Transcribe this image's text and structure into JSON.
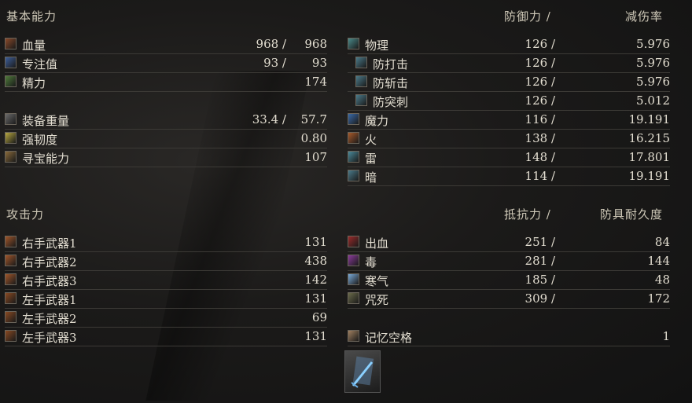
{
  "left": {
    "basic_header": "基本能力",
    "basic": [
      {
        "label": "血量",
        "a": "968 /",
        "b": "968",
        "color": "#8a4a2a",
        "icon": "hp-icon"
      },
      {
        "label": "专注值",
        "a": "93 /",
        "b": "93",
        "color": "#3d5f9a",
        "icon": "fp-icon"
      },
      {
        "label": "精力",
        "a": "",
        "b": "174",
        "color": "#4f7a3a",
        "icon": "stamina-icon"
      }
    ],
    "equip": [
      {
        "label": "装备重量",
        "a": "33.4 /",
        "b": "57.7",
        "color": "#6b6b6b",
        "icon": "equip-load-icon"
      },
      {
        "label": "强韧度",
        "a": "",
        "b": "0.80",
        "color": "#b8a840",
        "icon": "poise-icon"
      },
      {
        "label": "寻宝能力",
        "a": "",
        "b": "107",
        "color": "#8a6a3a",
        "icon": "discovery-icon"
      }
    ],
    "attack_header": "攻击力",
    "attack": [
      {
        "label": "右手武器1",
        "b": "131",
        "color": "#a0562a",
        "icon": "right-weapon-icon"
      },
      {
        "label": "右手武器2",
        "b": "438",
        "color": "#a0562a",
        "icon": "right-weapon-icon"
      },
      {
        "label": "右手武器3",
        "b": "142",
        "color": "#a0562a",
        "icon": "right-weapon-icon"
      },
      {
        "label": "左手武器1",
        "b": "131",
        "color": "#8a4a22",
        "icon": "left-weapon-icon"
      },
      {
        "label": "左手武器2",
        "b": "69",
        "color": "#8a4a22",
        "icon": "left-weapon-icon"
      },
      {
        "label": "左手武器3",
        "b": "131",
        "color": "#8a4a22",
        "icon": "left-weapon-icon"
      }
    ]
  },
  "right": {
    "def_header1": "防御力 /",
    "def_header2": "减伤率",
    "defense": [
      {
        "label": "物理",
        "a": "126 /",
        "b": "5.976",
        "color": "#4a8a8a",
        "icon": "physical-icon",
        "indent": false
      },
      {
        "label": "防打击",
        "a": "126 /",
        "b": "5.976",
        "color": "#4a7a8a",
        "icon": "strike-icon",
        "indent": true
      },
      {
        "label": "防斩击",
        "a": "126 /",
        "b": "5.976",
        "color": "#4a7a8a",
        "icon": "slash-icon",
        "indent": true
      },
      {
        "label": "防突刺",
        "a": "126 /",
        "b": "5.012",
        "color": "#4a7a8a",
        "icon": "thrust-icon",
        "indent": true
      },
      {
        "label": "魔力",
        "a": "116 /",
        "b": "19.191",
        "color": "#3a6aa8",
        "icon": "magic-icon",
        "indent": false
      },
      {
        "label": "火",
        "a": "138 /",
        "b": "16.215",
        "color": "#a85a2a",
        "icon": "fire-icon",
        "indent": false
      },
      {
        "label": "雷",
        "a": "148 /",
        "b": "17.801",
        "color": "#4a8a9a",
        "icon": "lightning-icon",
        "indent": false
      },
      {
        "label": "暗",
        "a": "114 /",
        "b": "19.191",
        "color": "#4a7a8a",
        "icon": "dark-icon",
        "indent": false
      }
    ],
    "res_header1": "抵抗力 /",
    "res_header2": "防具耐久度",
    "resist": [
      {
        "label": "出血",
        "a": "251 /",
        "b": "84",
        "color": "#9a2a2a",
        "icon": "bleed-icon"
      },
      {
        "label": "毒",
        "a": "281 /",
        "b": "144",
        "color": "#8a3a9a",
        "icon": "poison-icon"
      },
      {
        "label": "寒气",
        "a": "185 /",
        "b": "48",
        "color": "#7aaad8",
        "icon": "frost-icon"
      },
      {
        "label": "咒死",
        "a": "309 /",
        "b": "172",
        "color": "#6a6a4a",
        "icon": "curse-icon"
      }
    ],
    "memory": {
      "label": "记忆空格",
      "b": "1",
      "color": "#a08060",
      "icon": "attunement-icon"
    }
  }
}
